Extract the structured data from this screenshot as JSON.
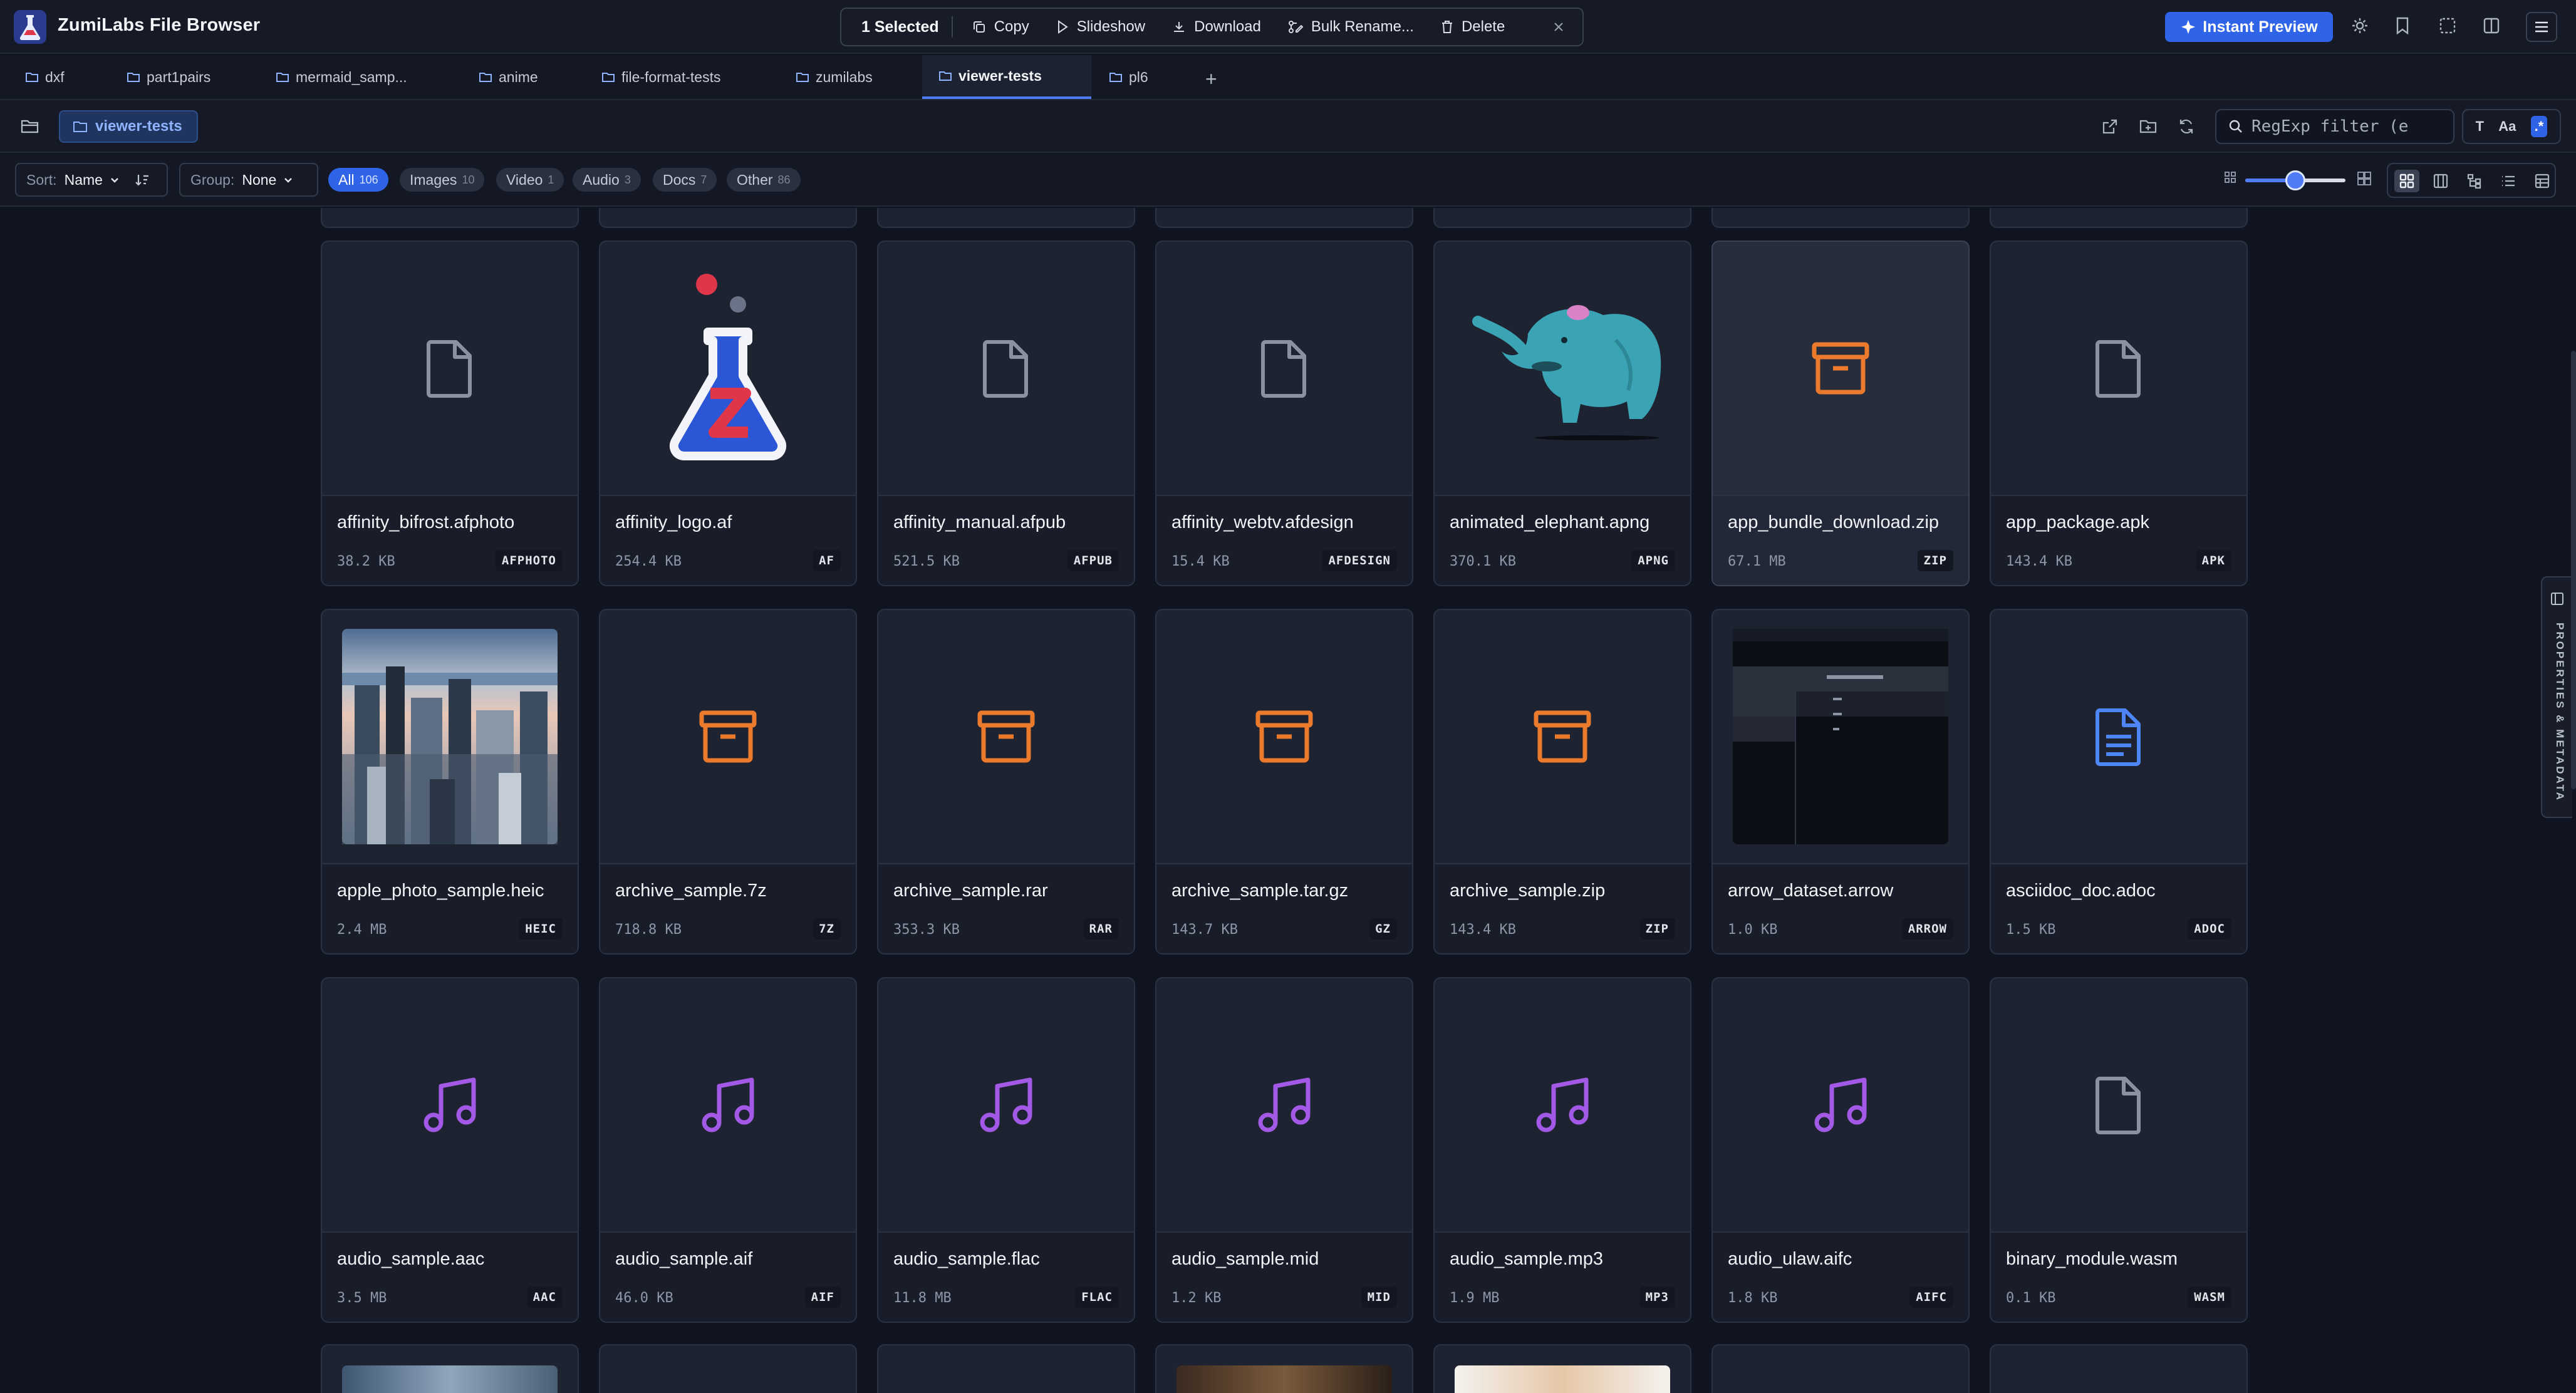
{
  "app": {
    "title": "ZumiLabs File Browser"
  },
  "selection": {
    "count_label": "1 Selected",
    "actions": [
      {
        "label": "Copy",
        "icon": "copy-icon"
      },
      {
        "label": "Slideshow",
        "icon": "play-icon"
      },
      {
        "label": "Download",
        "icon": "download-icon"
      },
      {
        "label": "Bulk Rename...",
        "icon": "rename-icon"
      },
      {
        "label": "Delete",
        "icon": "trash-icon"
      }
    ]
  },
  "header": {
    "instant_preview_label": "Instant Preview"
  },
  "tabs": [
    {
      "label": "dxf"
    },
    {
      "label": "part1pairs"
    },
    {
      "label": "mermaid_samp..."
    },
    {
      "label": "anime"
    },
    {
      "label": "file-format-tests"
    },
    {
      "label": "zumilabs"
    },
    {
      "label": "viewer-tests",
      "active": true
    },
    {
      "label": "pl6"
    }
  ],
  "path": {
    "current": "viewer-tests"
  },
  "filter": {
    "placeholder": "RegExp filter (e"
  },
  "text_options": {
    "type_label": "T",
    "case_label": "Aa",
    "regex_label": ".*"
  },
  "sort": {
    "label": "Sort:",
    "value": "Name"
  },
  "group": {
    "label": "Group:",
    "value": "None"
  },
  "type_filters": [
    {
      "label": "All",
      "count": "106",
      "active": true
    },
    {
      "label": "Images",
      "count": "10"
    },
    {
      "label": "Video",
      "count": "1"
    },
    {
      "label": "Audio",
      "count": "3"
    },
    {
      "label": "Docs",
      "count": "7"
    },
    {
      "label": "Other",
      "count": "86"
    }
  ],
  "thumbnail_size_fraction": 0.5,
  "files": [
    {
      "name": "affinity_bifrost.afphoto",
      "size": "38.2 KB",
      "ext": "AFPHOTO",
      "kind": "generic"
    },
    {
      "name": "affinity_logo.af",
      "size": "254.4 KB",
      "ext": "AF",
      "kind": "flask"
    },
    {
      "name": "affinity_manual.afpub",
      "size": "521.5 KB",
      "ext": "AFPUB",
      "kind": "generic"
    },
    {
      "name": "affinity_webtv.afdesign",
      "size": "15.4 KB",
      "ext": "AFDESIGN",
      "kind": "generic"
    },
    {
      "name": "animated_elephant.apng",
      "size": "370.1 KB",
      "ext": "APNG",
      "kind": "elephant"
    },
    {
      "name": "app_bundle_download.zip",
      "size": "67.1 MB",
      "ext": "ZIP",
      "kind": "archive",
      "selected": true
    },
    {
      "name": "app_package.apk",
      "size": "143.4 KB",
      "ext": "APK",
      "kind": "generic"
    },
    {
      "name": "apple_photo_sample.heic",
      "size": "2.4 MB",
      "ext": "HEIC",
      "kind": "city"
    },
    {
      "name": "archive_sample.7z",
      "size": "718.8 KB",
      "ext": "7Z",
      "kind": "archive"
    },
    {
      "name": "archive_sample.rar",
      "size": "353.3 KB",
      "ext": "RAR",
      "kind": "archive"
    },
    {
      "name": "archive_sample.tar.gz",
      "size": "143.7 KB",
      "ext": "GZ",
      "kind": "archive"
    },
    {
      "name": "archive_sample.zip",
      "size": "143.4 KB",
      "ext": "ZIP",
      "kind": "archive"
    },
    {
      "name": "arrow_dataset.arrow",
      "size": "1.0 KB",
      "ext": "ARROW",
      "kind": "screenshot"
    },
    {
      "name": "asciidoc_doc.adoc",
      "size": "1.5 KB",
      "ext": "ADOC",
      "kind": "doc"
    },
    {
      "name": "audio_sample.aac",
      "size": "3.5 MB",
      "ext": "AAC",
      "kind": "audio"
    },
    {
      "name": "audio_sample.aif",
      "size": "46.0 KB",
      "ext": "AIF",
      "kind": "audio"
    },
    {
      "name": "audio_sample.flac",
      "size": "11.8 MB",
      "ext": "FLAC",
      "kind": "audio"
    },
    {
      "name": "audio_sample.mid",
      "size": "1.2 KB",
      "ext": "MID",
      "kind": "audio"
    },
    {
      "name": "audio_sample.mp3",
      "size": "1.9 MB",
      "ext": "MP3",
      "kind": "audio"
    },
    {
      "name": "audio_ulaw.aifc",
      "size": "1.8 KB",
      "ext": "AIFC",
      "kind": "audio"
    },
    {
      "name": "binary_module.wasm",
      "size": "0.1 KB",
      "ext": "WASM",
      "kind": "generic"
    }
  ],
  "side_panel": {
    "label": "PROPERTIES & METADATA"
  },
  "colors": {
    "accent": "#2f64e8",
    "archive_icon": "#ec7a2c",
    "audio_icon": "#a259e6",
    "doc_icon": "#4f86f7",
    "generic_icon": "#8b91a0"
  }
}
